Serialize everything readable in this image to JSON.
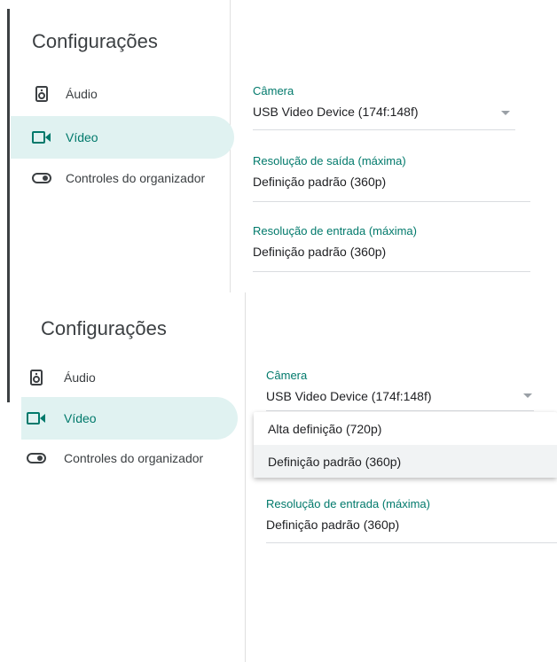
{
  "top": {
    "title": "Configurações",
    "nav": [
      {
        "label": "Áudio",
        "icon": "speaker-icon"
      },
      {
        "label": "Vídeo",
        "icon": "video-camera-icon"
      },
      {
        "label": "Controles do organizador",
        "icon": "toggle-icon"
      }
    ],
    "active_nav": "Vídeo",
    "fields": {
      "camera": {
        "label": "Câmera",
        "value": "USB Video Device (174f:148f)"
      },
      "output_res": {
        "label": "Resolução de saída (máxima)",
        "value": "Definição padrão (360p)"
      },
      "input_res": {
        "label": "Resolução de entrada (máxima)",
        "value": "Definição padrão (360p)"
      }
    }
  },
  "bottom": {
    "title": "Configurações",
    "nav": [
      {
        "label": "Áudio",
        "icon": "speaker-icon"
      },
      {
        "label": "Vídeo",
        "icon": "video-camera-icon"
      },
      {
        "label": "Controles do organizador",
        "icon": "toggle-icon"
      }
    ],
    "active_nav": "Vídeo",
    "fields": {
      "camera": {
        "label": "Câmera",
        "value": "USB Video Device (174f:148f)"
      },
      "input_res": {
        "label": "Resolução de entrada (máxima)",
        "value": "Definição padrão (360p)"
      }
    },
    "dropdown_menu": {
      "options": [
        "Alta definição (720p)",
        "Definição padrão (360p)"
      ],
      "selected": "Definição padrão (360p)"
    }
  },
  "colors": {
    "accent": "#00796b",
    "active_nav_bg": "#e0f2f1",
    "divider": "#dadce0"
  }
}
